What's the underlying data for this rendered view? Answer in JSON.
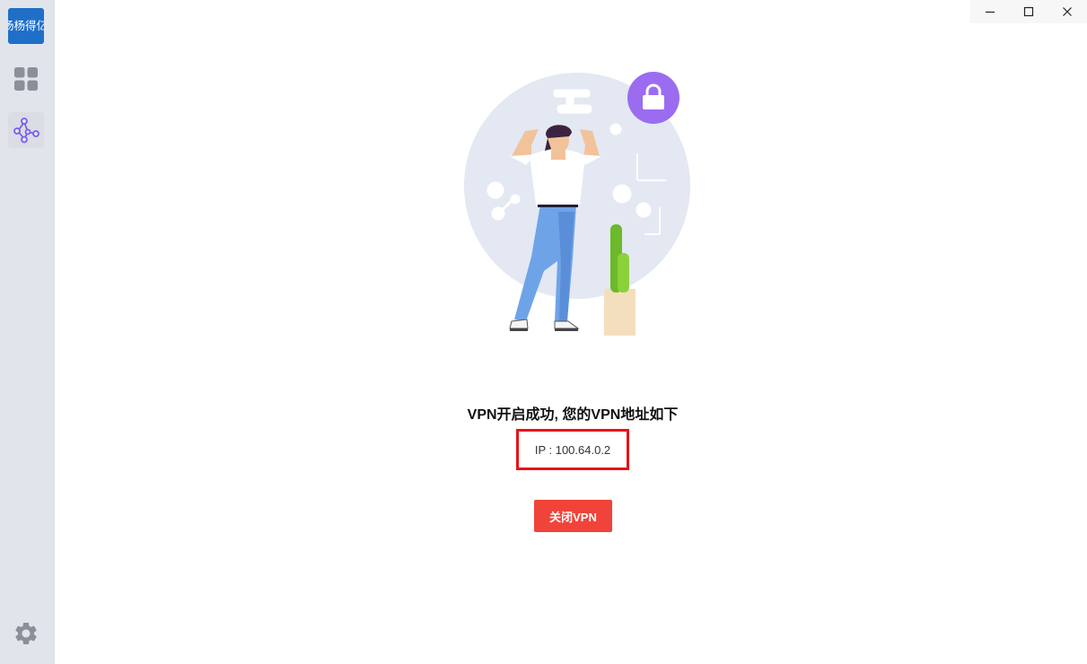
{
  "sidebar": {
    "logo_text": "杨杨得亿",
    "items": [
      {
        "icon": "grid-icon"
      },
      {
        "icon": "network-icon",
        "active": true
      }
    ],
    "settings_icon": "gear-icon"
  },
  "window_controls": {
    "minimize": "minimize-icon",
    "maximize": "maximize-icon",
    "close": "close-icon"
  },
  "main": {
    "headline": "VPN开启成功, 您的VPN地址如下",
    "ip_text": "IP : 100.64.0.2",
    "close_button_label": "关闭VPN"
  },
  "colors": {
    "logo_bg": "#1f6fc8",
    "accent_purple": "#9b6cf0",
    "button_red": "#f0443a",
    "highlight_red": "#e8131a",
    "sidebar_bg": "#e1e4ea"
  }
}
